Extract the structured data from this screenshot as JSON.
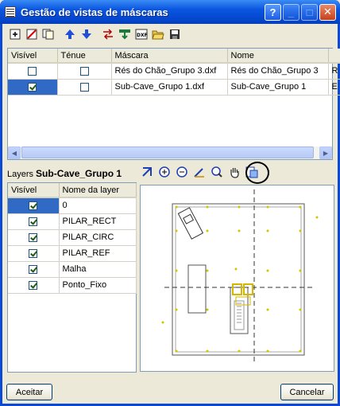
{
  "window": {
    "title": "Gestão de vistas de máscaras"
  },
  "title_buttons": {
    "help": "?",
    "minimize": "_",
    "maximize": "□",
    "close": "✕"
  },
  "toolbar": [
    {
      "name": "add-icon",
      "glyph": "+"
    },
    {
      "name": "delete-icon",
      "glyph": "⊘"
    },
    {
      "name": "copy-icon",
      "glyph": "❐"
    },
    {
      "name": "move-up-icon",
      "glyph": "⬆"
    },
    {
      "name": "move-down-icon",
      "glyph": "⬇"
    },
    {
      "name": "swap-icon",
      "glyph": "⇄"
    },
    {
      "name": "import-icon",
      "glyph": "⬇"
    },
    {
      "name": "dwg-icon",
      "glyph": "▣"
    },
    {
      "name": "open-folder-icon",
      "glyph": "📂"
    },
    {
      "name": "save-icon",
      "glyph": "💾"
    }
  ],
  "masks_table": {
    "columns": [
      "Visível",
      "Ténue",
      "Máscara",
      "Nome",
      ""
    ],
    "rows": [
      {
        "visible": false,
        "faint": false,
        "mask": "Rés do Chão_Grupo 3.dxf",
        "name": "Rés do Chão_Grupo 3",
        "extra": "R"
      },
      {
        "visible": true,
        "faint": false,
        "mask": "Sub-Cave_Grupo 1.dxf",
        "name": "Sub-Cave_Grupo 1",
        "extra": "E"
      }
    ]
  },
  "layers": {
    "label": "Layers",
    "group": "Sub-Cave_Grupo 1",
    "columns": [
      "Visível",
      "Nome da layer"
    ],
    "rows": [
      {
        "visible": true,
        "name": "0",
        "selected": true
      },
      {
        "visible": true,
        "name": "PILAR_RECT"
      },
      {
        "visible": true,
        "name": "PILAR_CIRC"
      },
      {
        "visible": true,
        "name": "PILAR_REF"
      },
      {
        "visible": true,
        "name": "Malha"
      },
      {
        "visible": true,
        "name": "Ponto_Fixo"
      }
    ]
  },
  "preview_tools": [
    "zoom-extents-icon",
    "zoom-in-icon",
    "zoom-out-icon",
    "zoom-window-icon",
    "zoom-previous-icon",
    "pan-hand-icon",
    "print-preview-icon"
  ],
  "buttons": {
    "ok": "Aceitar",
    "cancel": "Cancelar"
  }
}
